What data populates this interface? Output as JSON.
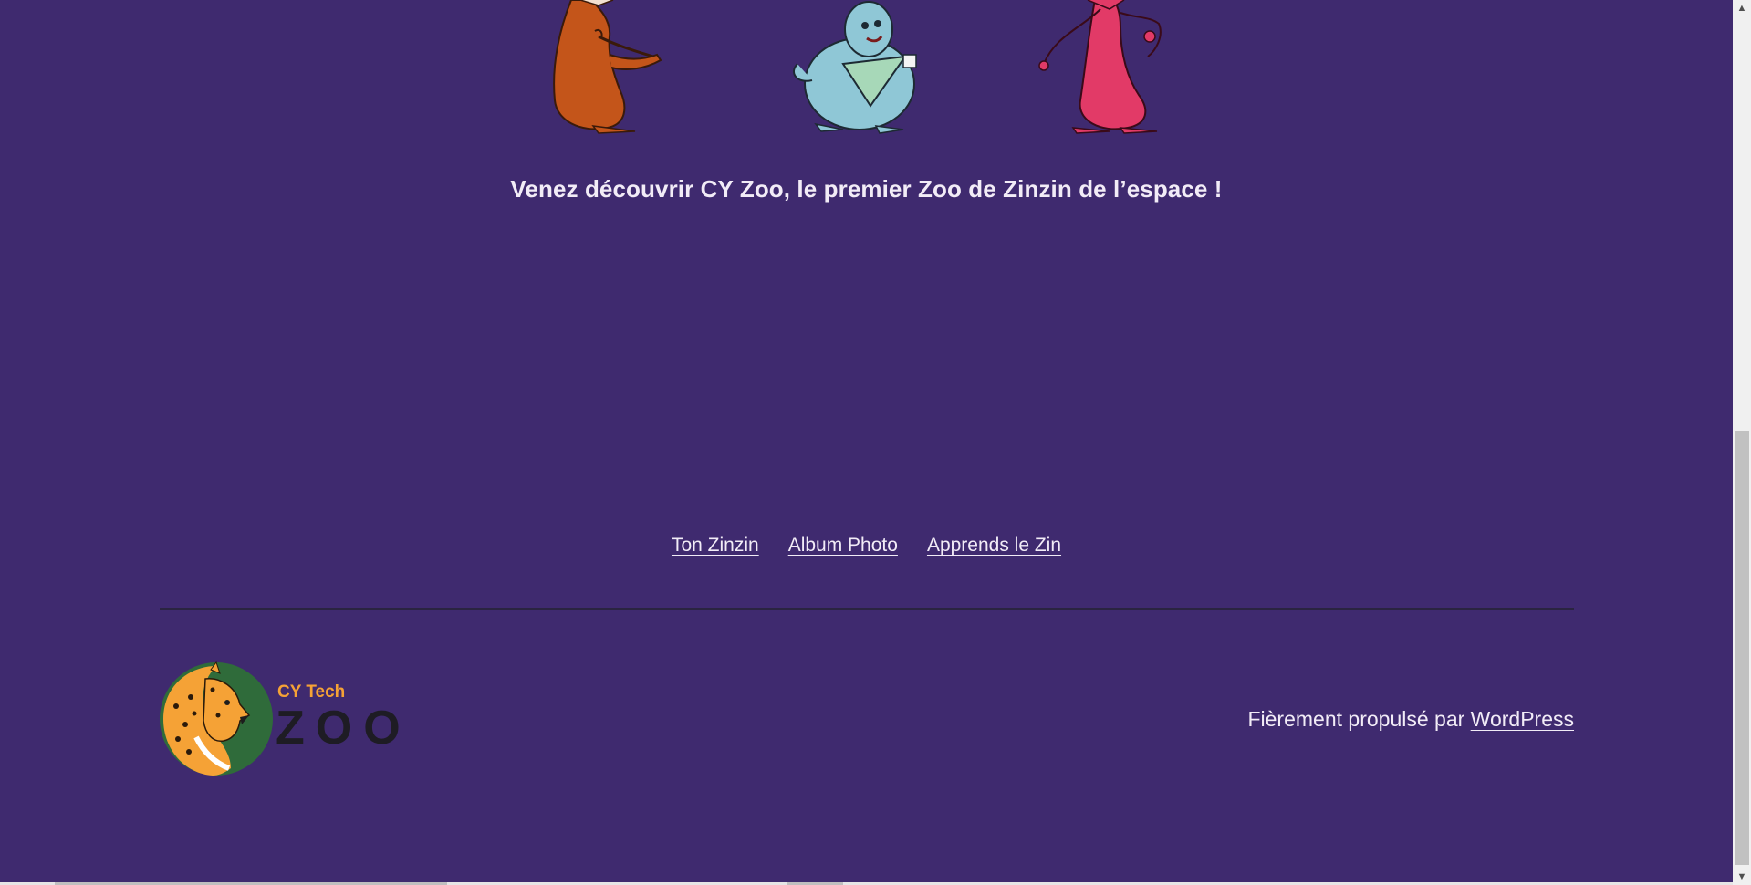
{
  "main": {
    "tagline": "Venez découvrir CY Zoo, le premier Zoo de Zinzin de l’espace !"
  },
  "nav": {
    "items": [
      {
        "label": "Ton Zinzin"
      },
      {
        "label": "Album Photo"
      },
      {
        "label": "Apprends le Zin"
      }
    ]
  },
  "footer": {
    "logo": {
      "top_text": "CY Tech",
      "main_text": "ZOO"
    },
    "credit_prefix": "Fièrement propulsé par ",
    "credit_link": "WordPress"
  },
  "colors": {
    "background": "#3f2a6f",
    "text": "#f2ecf7",
    "logo_orange": "#f5a236",
    "logo_green": "#2f6b3a"
  }
}
